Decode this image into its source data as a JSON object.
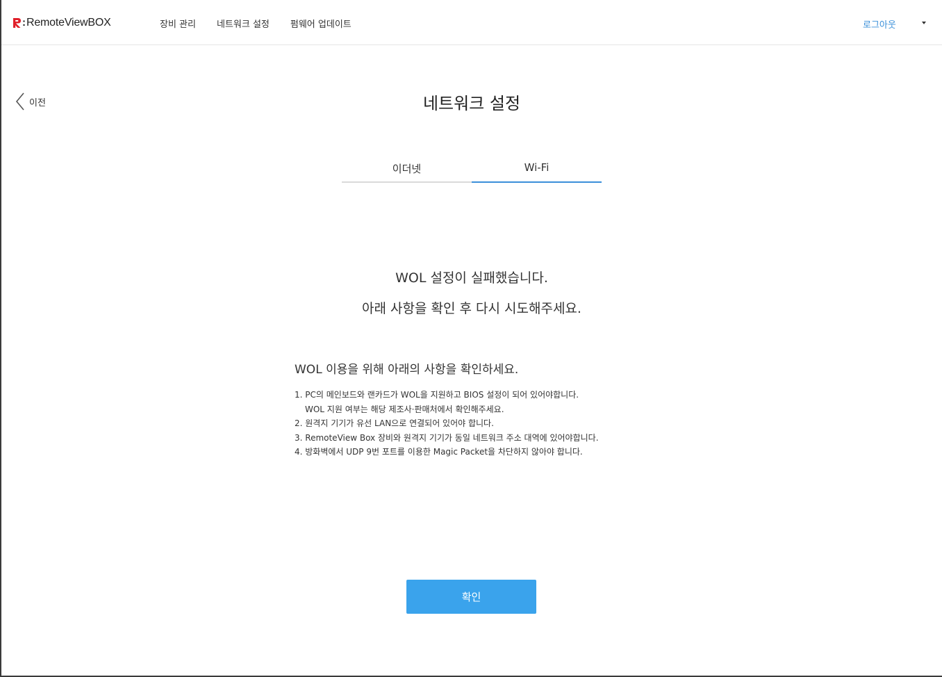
{
  "header": {
    "logo_text": "RemoteViewBOX",
    "brand_color": "#e0202a",
    "nav": [
      "장비 관리",
      "네트워크 설정",
      "펌웨어 업데이트"
    ],
    "logout_label": "로그아웃"
  },
  "back": {
    "label": "이전",
    "icon": "chevron-left-icon"
  },
  "page": {
    "title": "네트워크 설정"
  },
  "tabs": [
    {
      "label": "이더넷",
      "active": false
    },
    {
      "label": "Wi-Fi",
      "active": true
    }
  ],
  "result": {
    "line1": "WOL 설정이 실패했습니다.",
    "line2": "아래 사항을 확인 후 다시 시도해주세요."
  },
  "info": {
    "title": "WOL 이용을 위해 아래의 사항을 확인하세요.",
    "items": [
      "1. PC의 메인보드와 랜카드가 WOL을 지원하고 BIOS 설정이 되어 있어야합니다.",
      "WOL 지원 여부는 해당 제조사·판매처에서 확인해주세요.",
      "2. 원격지 기기가 유선 LAN으로 연결되어 있어야 합니다.",
      "3. RemoteView Box 장비와 원격지 기기가 동일 네트워크 주소 대역에 있어야합니다.",
      "4. 방화벽에서 UDP 9번 포트를 이용한 Magic Packet을 차단하지 않아야 합니다."
    ]
  },
  "confirm_label": "확인",
  "colors": {
    "accent": "#3a8fd9",
    "button": "#3aa3ec"
  }
}
